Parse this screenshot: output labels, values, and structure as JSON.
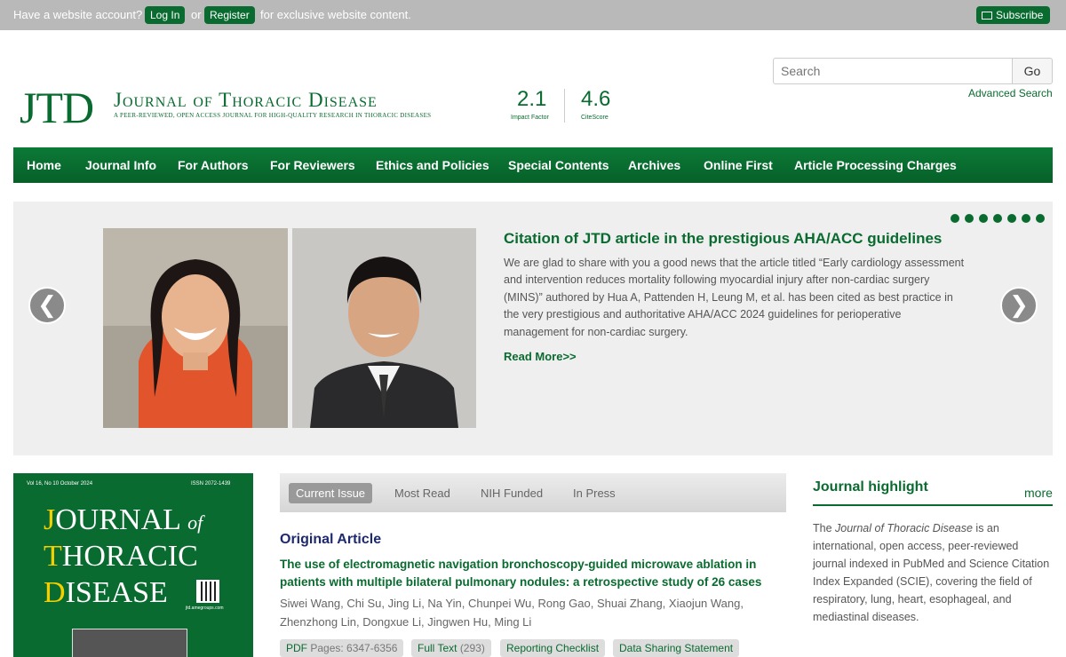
{
  "topbar": {
    "prompt": "Have a website account?",
    "login": "Log In",
    "or": "or",
    "register": "Register",
    "suffix": "for exclusive website content.",
    "subscribe": "Subscribe"
  },
  "header": {
    "logo_letters": "JTD",
    "journal_name": "Journal of Thoracic Disease",
    "tagline": "A peer-reviewed, open access journal for high-quality research in thoracic diseases",
    "impact_factor": "2.1",
    "impact_factor_label": "Impact Factor",
    "citescore": "4.6",
    "citescore_label": "CiteScore"
  },
  "search": {
    "placeholder": "Search",
    "go": "Go",
    "advanced": "Advanced Search"
  },
  "nav": [
    "Home",
    "Journal Info",
    "For Authors",
    "For Reviewers",
    "Ethics and Policies",
    "Special Contents",
    "Archives",
    "Online First",
    "Article Processing Charges"
  ],
  "slider": {
    "title": "Citation of JTD article in the prestigious AHA/ACC guidelines",
    "body": "We are glad to share with you a good news that the article titled “Early cardiology assessment and intervention reduces mortality following myocardial injury after non-cardiac surgery (MINS)” authored by Hua A, Pattenden H, Leung M, et al. has been cited as best practice in the very prestigious and authoritative AHA/ACC 2024 guidelines for perioperative management for non-cardiac surgery.",
    "read_more": "Read More>>",
    "prev": "❮",
    "next": "❯",
    "dot_count": 7
  },
  "cover": {
    "issue": "Vol 16, No 10 October 2024",
    "issn": "ISSN 2072-1439",
    "line1_initial": "J",
    "line1_rest": "OURNAL",
    "line1_of": "of",
    "line2_initial": "T",
    "line2_rest": "HORACIC",
    "line3_initial": "D",
    "line3_rest": "ISEASE",
    "site": "jtd.amegroups.com"
  },
  "tabs": [
    "Current Issue",
    "Most Read",
    "NIH Funded",
    "In Press"
  ],
  "article": {
    "section": "Original Article",
    "title": "The use of electromagnetic navigation bronchoscopy-guided microwave ablation in patients with multiple bilateral pulmonary nodules: a retrospective study of 26 cases",
    "authors": "Siwei Wang, Chi Su, Jing Li, Na Yin, Chunpei Wu, Rong Gao, Shuai Zhang, Xiaojun Wang, Zhenzhong Lin, Dongxue Li, Jingwen Hu, Ming Li",
    "pdf_label": "PDF",
    "pdf_pages": "Pages: 6347-6356",
    "fulltext_label": "Full Text",
    "fulltext_count": "(293)",
    "checklist": "Reporting Checklist",
    "datasharing": "Data Sharing Statement"
  },
  "highlight": {
    "title": "Journal highlight",
    "more": "more",
    "body_pre": "The ",
    "body_journal": "Journal of Thoracic Disease",
    "body_post": " is an international, open access, peer-reviewed journal indexed in PubMed and Science Citation Index Expanded (SCIE), covering the field of respiratory, lung, heart, esophageal, and mediastinal diseases."
  }
}
